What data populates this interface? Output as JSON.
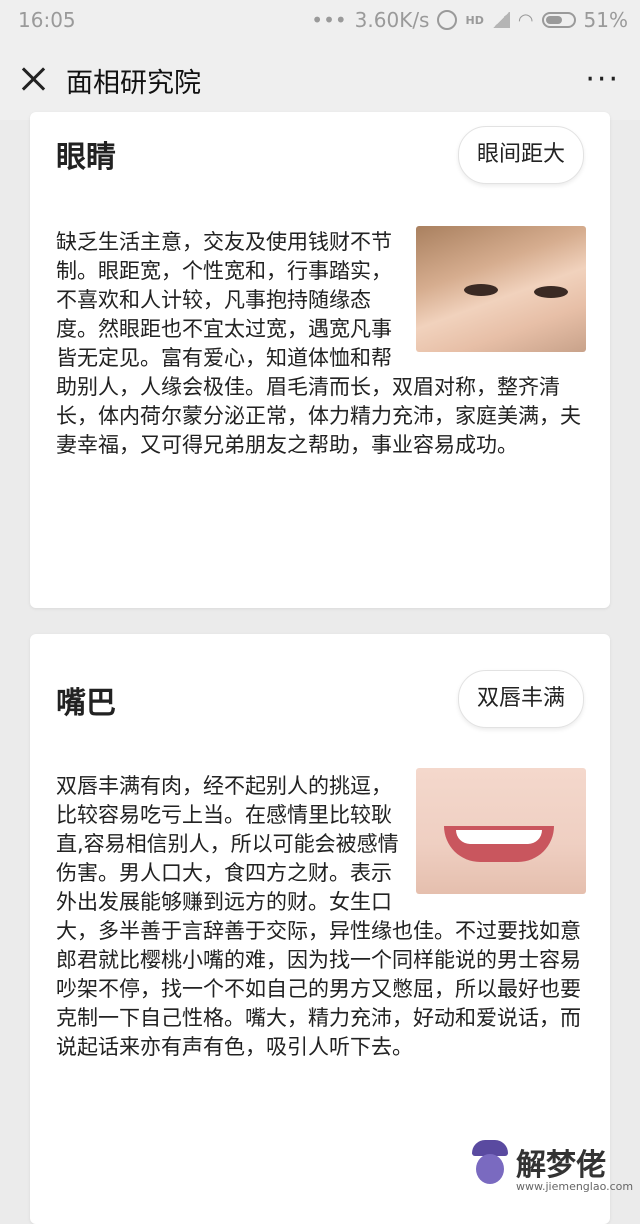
{
  "status_bar": {
    "time": "16:05",
    "dots": "•••",
    "speed": "3.60K/s",
    "hd": "HD",
    "battery": "51%"
  },
  "title_bar": {
    "title": "面相研究院",
    "more": "···"
  },
  "cards": [
    {
      "title": "眼睛",
      "tag": "眼间距大",
      "text": "缺乏生活主意，交友及使用钱财不节制。眼距宽，个性宽和，行事踏实，不喜欢和人计较，凡事抱持随缘态度。然眼距也不宜太过宽，遇宽凡事皆无定见。富有爱心，知道体恤和帮助别人，人缘会极佳。眉毛清而长，双眉对称，整齐清长，体内荷尔蒙分泌正常，体力精力充沛，家庭美满，夫妻幸福，又可得兄弟朋友之帮助，事业容易成功。"
    },
    {
      "title": "嘴巴",
      "tag": "双唇丰满",
      "text": "双唇丰满有肉，经不起别人的挑逗，比较容易吃亏上当。在感情里比较耿直,容易相信别人，所以可能会被感情伤害。男人口大，食四方之财。表示外出发展能够赚到远方的财。女生口大，多半善于言辞善于交际，异性缘也佳。不过要找如意郎君就比樱桃小嘴的难，因为找一个同样能说的男士容易吵架不停，找一个不如自己的男方又憋屈，所以最好也要克制一下自己性格。嘴大，精力充沛，好动和爱说话，而说起话来亦有声有色，吸引人听下去。"
    }
  ],
  "watermark": {
    "text": "解梦佬",
    "url": "www.jiemenglao.com"
  }
}
